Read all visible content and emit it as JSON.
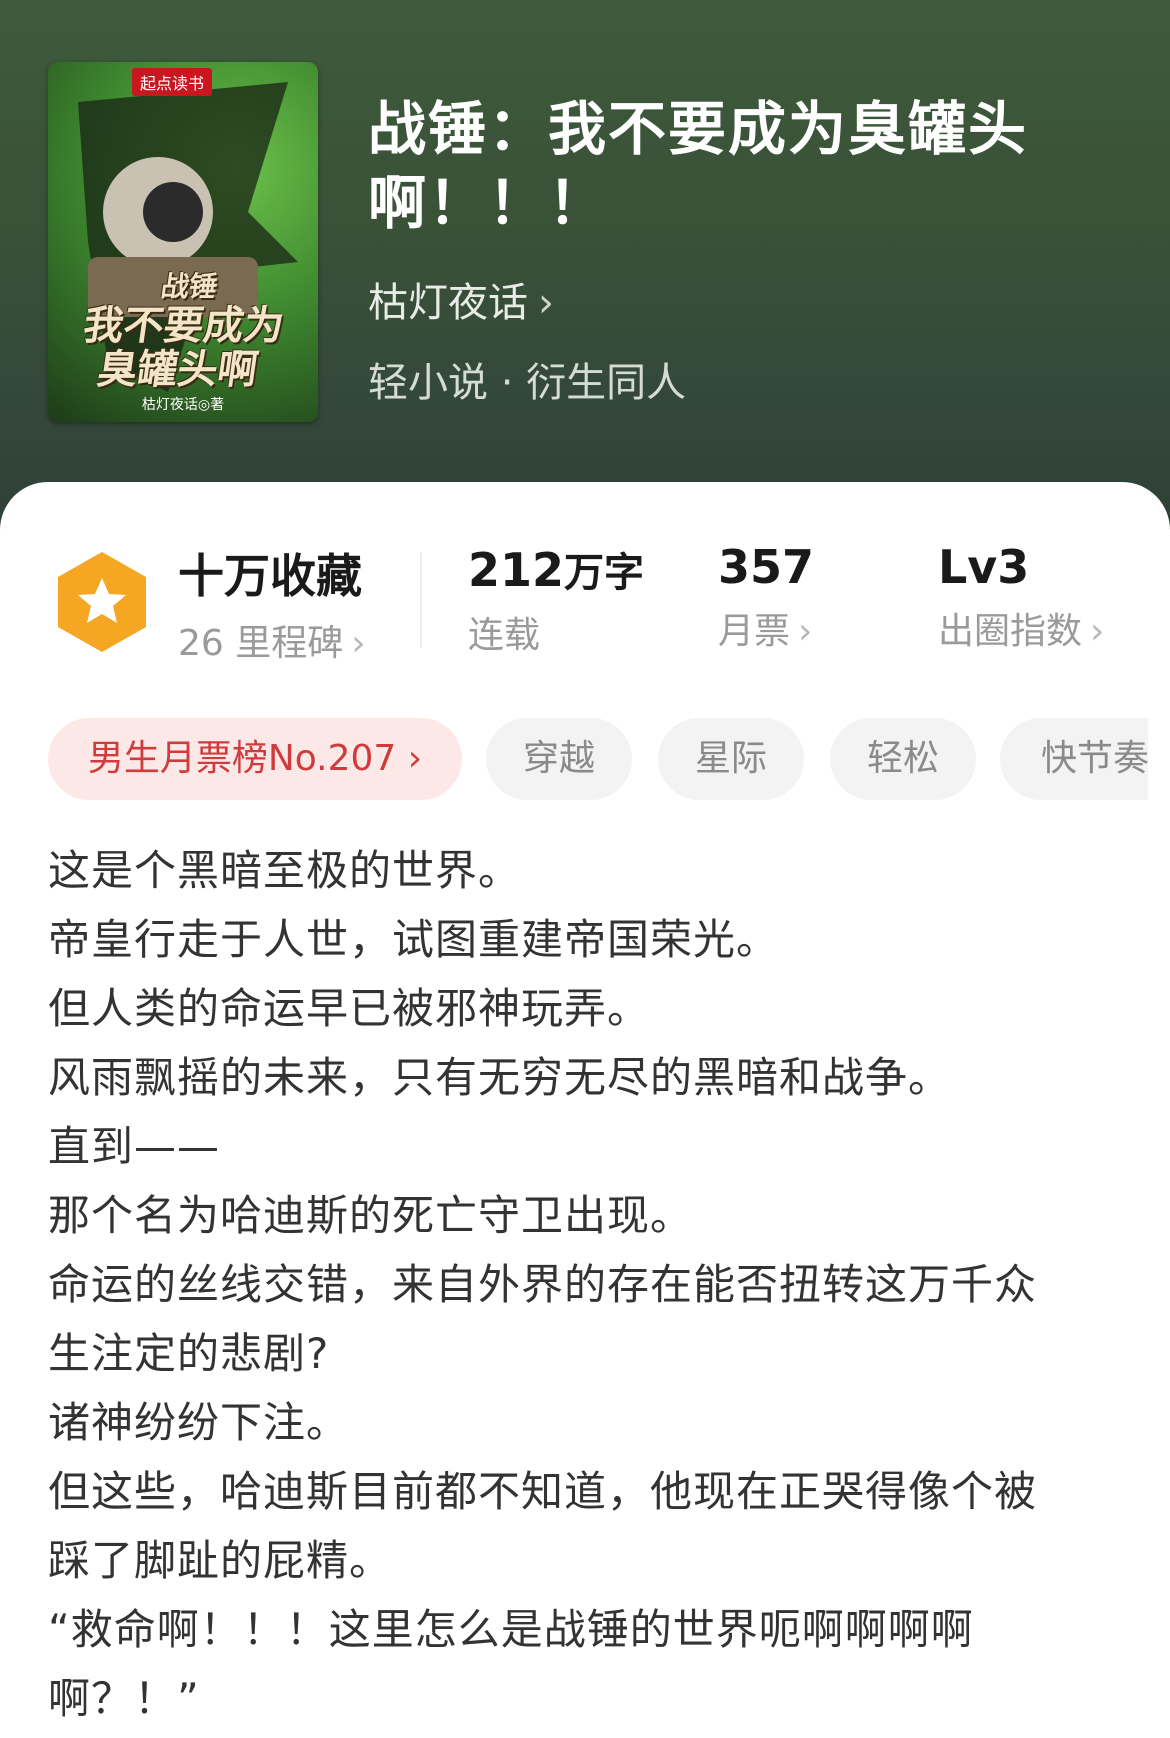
{
  "book": {
    "cover_logo": "起点读书",
    "cover_title_line1": "战锤",
    "cover_title_line2": "我不要成为",
    "cover_title_line3": "臭罐头啊",
    "cover_author": "枯灯夜话◎著",
    "title": "战锤：我不要成为臭罐头啊！！！",
    "author": "枯灯夜话",
    "genre": "轻小说 · 衍生同人"
  },
  "stats": {
    "collect_label": "十万收藏",
    "milestone": "26 里程碑",
    "words_num": "212",
    "words_unit": "万字",
    "status": "连载",
    "tickets_value": "357",
    "tickets_label": "月票",
    "index_value": "Lv3",
    "index_label": "出圈指数",
    "badge_color": "#f5a623"
  },
  "tags": [
    {
      "label": "男生月票榜No.207 ›"
    },
    {
      "label": "穿越"
    },
    {
      "label": "星际"
    },
    {
      "label": "轻松"
    },
    {
      "label": "快节奏"
    }
  ],
  "blurb": [
    "这是个黑暗至极的世界。",
    "帝皇行走于人世，试图重建帝国荣光。",
    "但人类的命运早已被邪神玩弄。",
    "风雨飘摇的未来，只有无穷无尽的黑暗和战争。",
    "直到——",
    "那个名为哈迪斯的死亡守卫出现。",
    "命运的丝线交错，来自外界的存在能否扭转这万千众",
    "生注定的悲剧?",
    "诸神纷纷下注。",
    "但这些，哈迪斯目前都不知道，他现在正哭得像个被",
    "踩了脚趾的屁精。",
    "“救命啊！！！这里怎么是战锤的世界呃啊啊啊啊",
    "啊？！”"
  ]
}
